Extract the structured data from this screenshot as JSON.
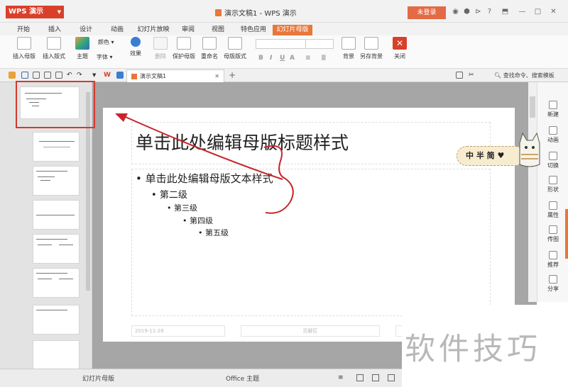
{
  "app": {
    "logo": "WPS 演示",
    "title": "演示文稿1 - WPS 演示",
    "login": "未登录"
  },
  "tabs": [
    "开始",
    "插入",
    "设计",
    "动画",
    "幻灯片放映",
    "审阅",
    "视图",
    "特色应用",
    "幻灯片母版"
  ],
  "toolbar": {
    "insert_master": "插入母版",
    "insert_layout": "插入版式",
    "theme": "主题",
    "colors": "颜色",
    "fonts": "字体",
    "effects": "效果",
    "delete": "删除",
    "protect_master": "保护母版",
    "rename": "重命名",
    "master_layout": "母版版式",
    "background": "背景",
    "save_background": "另存背景",
    "close": "关闭",
    "bold": "B",
    "italic": "I",
    "underline": "U",
    "font_color": "A"
  },
  "doc_tab": {
    "label": "演示文稿1"
  },
  "search_hint": "查找命令、搜索模板",
  "slide": {
    "title": "单击此处编辑母版标题样式",
    "levels": [
      "单击此处编辑母版文本样式",
      "第二级",
      "第三级",
      "第四级",
      "第五级"
    ],
    "date": "2019-11-28",
    "footer": "页脚区"
  },
  "right_panel": [
    "新建",
    "动画",
    "切换",
    "形状",
    "属性",
    "传图",
    "推荐",
    "分享"
  ],
  "status": {
    "mode": "幻灯片母版",
    "theme": "Office 主题"
  },
  "badge": "中 半 简",
  "watermark": "软件技巧",
  "colors": {
    "accent": "#e8773a",
    "logo": "#d9402a",
    "annotation": "#c8252a"
  }
}
